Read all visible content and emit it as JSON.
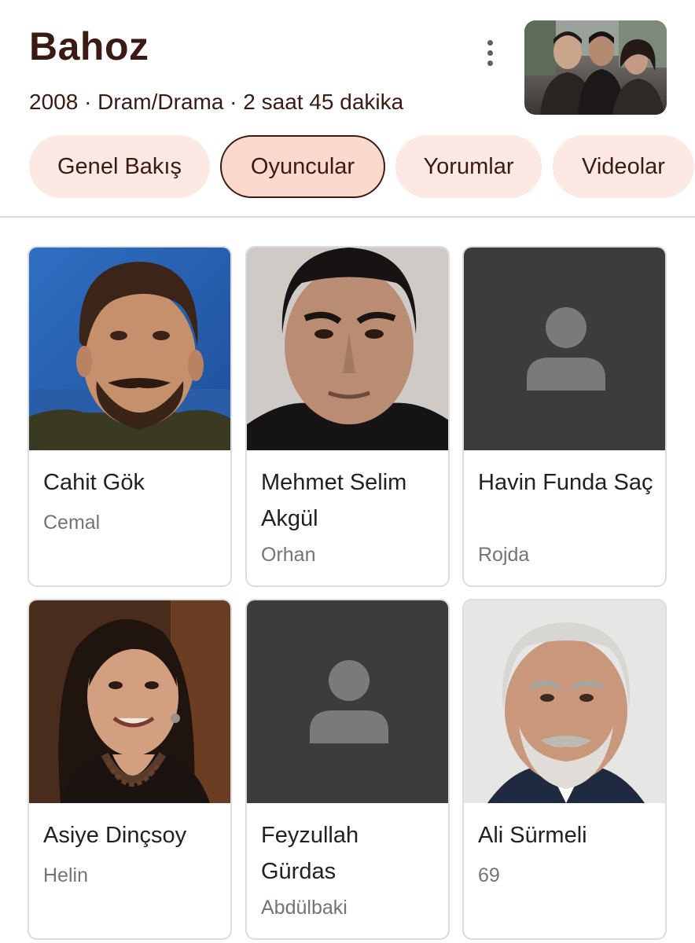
{
  "header": {
    "title": "Bahoz",
    "meta": "2008 · Dram/Drama · 2 saat 45 dakika"
  },
  "tabs": [
    {
      "label": "Genel Bakış",
      "active": false
    },
    {
      "label": "Oyuncular",
      "active": true
    },
    {
      "label": "Yorumlar",
      "active": false
    },
    {
      "label": "Videolar",
      "active": false
    }
  ],
  "cast": [
    {
      "name": "Cahit Gök",
      "role": "Cemal",
      "photo": "actor-photo"
    },
    {
      "name": "Mehmet Selim Akgül",
      "role": "Orhan",
      "photo": "actor-photo"
    },
    {
      "name": "Havin Funda Saç",
      "role": "Rojda",
      "photo": "placeholder-person-icon"
    },
    {
      "name": "Asiye Dinçsoy",
      "role": "Helin",
      "photo": "actor-photo"
    },
    {
      "name": "Feyzullah Gürdas",
      "role": "Abdülbaki",
      "photo": "placeholder-person-icon"
    },
    {
      "name": "Ali Sürmeli",
      "role": "69",
      "photo": "actor-photo"
    }
  ],
  "colors": {
    "title_text": "#3c1a14",
    "tab_background": "#fde9e3",
    "tab_active_background": "#fbd9cd",
    "placeholder_background": "#3c3c3c",
    "placeholder_icon": "#7a7a7a"
  }
}
